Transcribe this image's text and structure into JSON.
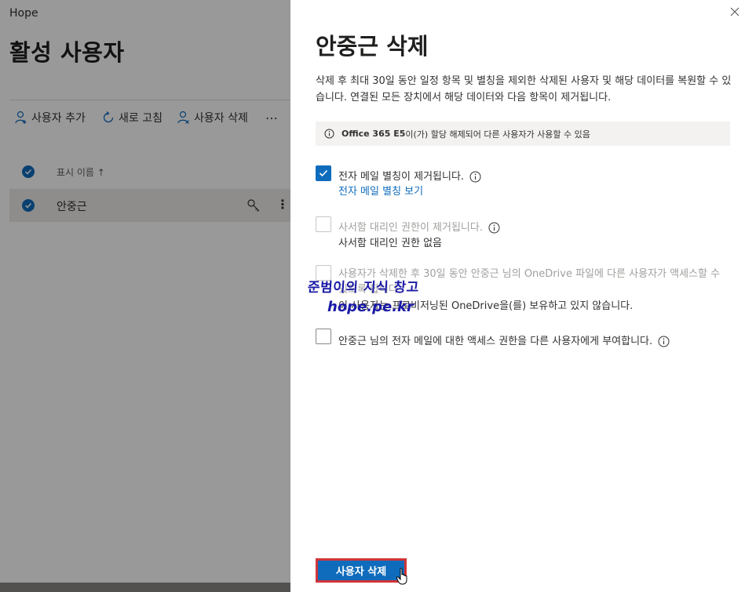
{
  "app": {
    "name": "Hope"
  },
  "page": {
    "title": "활성 사용자"
  },
  "command_bar": {
    "add_user": "사용자 추가",
    "refresh": "새로 고침",
    "delete_user": "사용자 삭제",
    "more": "⋯"
  },
  "user_list": {
    "column_header": "표시 이름 ↑",
    "rows": [
      {
        "display_name": "안중근",
        "more": "⋮"
      }
    ]
  },
  "panel": {
    "title": "안중근 삭제",
    "description": "삭제 후 최대 30일 동안 일정 항목 및 별칭을 제외한 삭제된 사용자 및 해당 데이터를 복원할 수 있습니다. 연결된 모든 장치에서 해당 데이터와 다음 항목이 제거됩니다.",
    "info_bar": {
      "license": "Office 365 E5",
      "text": "이(가) 할당 해제되어 다른 사용자가 사용할 수 있음"
    },
    "options": [
      {
        "label": "전자 메일 별칭이 제거됩니다.",
        "sub": "전자 메일 별칭 보기",
        "checked": true,
        "disabled": false
      },
      {
        "label": "사서함 대리인 권한이 제거됩니다.",
        "sub": "사서함 대리인 권한 없음",
        "checked": false,
        "disabled": true
      },
      {
        "label": "사용자가 삭제한 후 30일 동안 안중근 님의 OneDrive 파일에 다른 사용자가 액세스할 수 있도록 합니다.",
        "sub": "이 사용자는 프로비저닝된 OneDrive을(를) 보유하고 있지 않습니다.",
        "checked": false,
        "disabled": true
      },
      {
        "label": "안중근 님의 전자 메일에 대한 액세스 권한을 다른 사용자에게 부여합니다.",
        "checked": false,
        "disabled": false
      }
    ],
    "primary_button": "사용자 삭제"
  },
  "watermark": {
    "line1": "준범이의 지식 창고",
    "line2": "hope.pe.kr"
  },
  "colors": {
    "accent": "#0f6cbd",
    "highlight_border": "#d13438",
    "overlay": "rgba(0,0,0,0.4)",
    "info_bar_bg": "#f3f2f1"
  }
}
